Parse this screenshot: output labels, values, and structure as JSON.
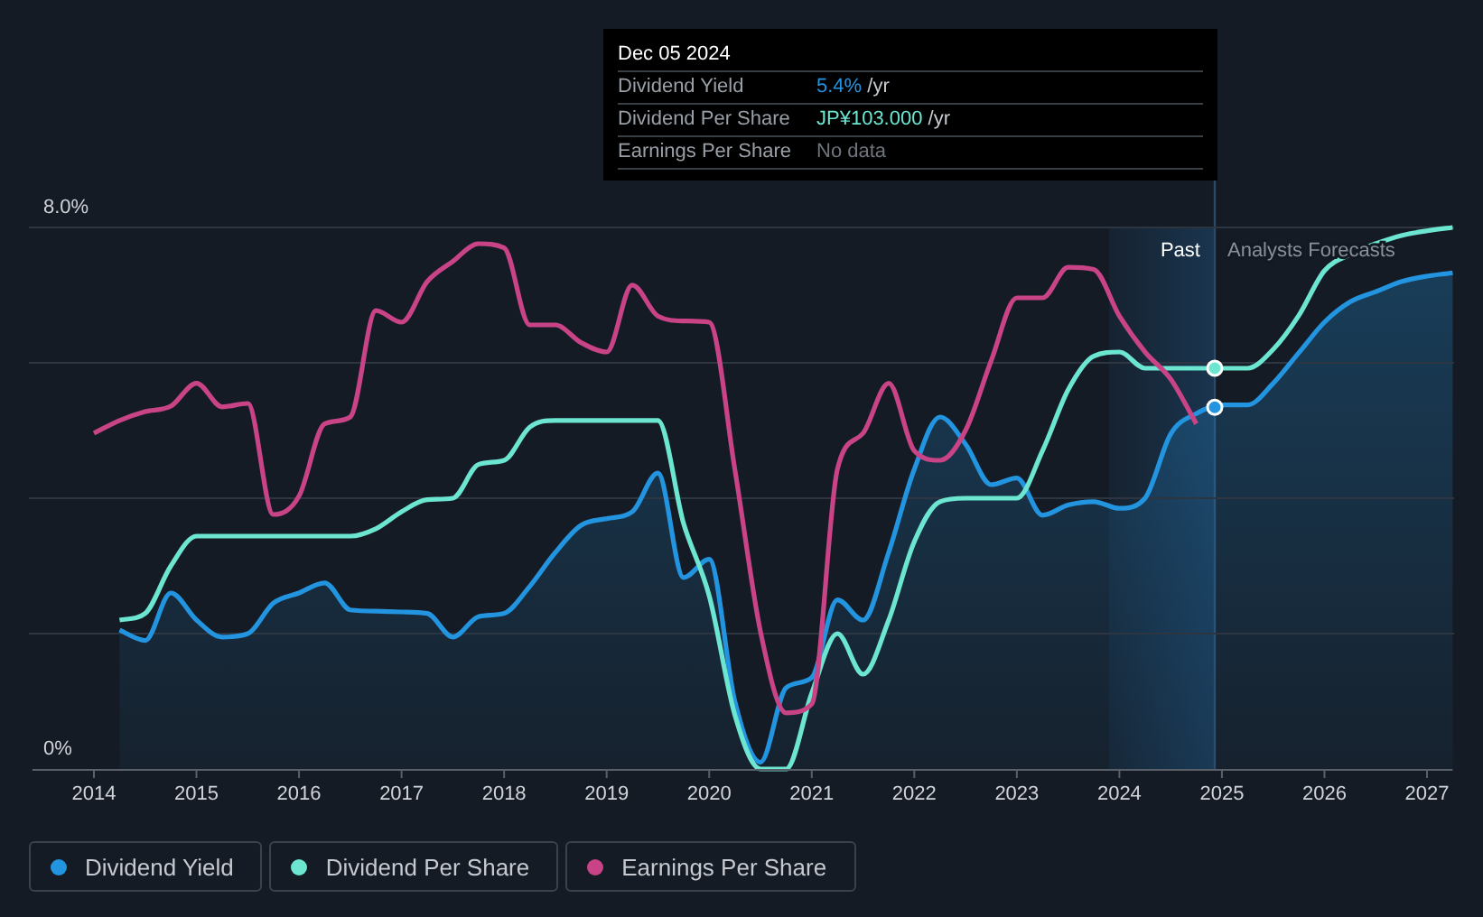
{
  "chart_data": {
    "type": "line",
    "yticks": [
      {
        "value": 0,
        "label": "0%"
      },
      {
        "value": 8,
        "label": "8.0%"
      }
    ],
    "ylim": [
      0,
      8
    ],
    "xticks": [
      2014,
      2015,
      2016,
      2017,
      2018,
      2019,
      2020,
      2021,
      2022,
      2023,
      2024,
      2025,
      2026,
      2027
    ],
    "xlim": [
      2013.4,
      2027.25
    ],
    "x": [
      2014.0,
      2014.25,
      2014.5,
      2014.75,
      2015.0,
      2015.25,
      2015.5,
      2015.75,
      2016.0,
      2016.25,
      2016.5,
      2016.75,
      2017.0,
      2017.25,
      2017.5,
      2017.75,
      2018.0,
      2018.25,
      2018.5,
      2018.75,
      2019.0,
      2019.25,
      2019.5,
      2019.75,
      2020.0,
      2020.25,
      2020.5,
      2020.75,
      2021.0,
      2021.25,
      2021.5,
      2021.75,
      2022.0,
      2022.25,
      2022.5,
      2022.75,
      2023.0,
      2023.25,
      2023.5,
      2023.75,
      2024.0,
      2024.25,
      2024.5,
      2024.75,
      2025.0,
      2025.25,
      2025.5,
      2025.75,
      2026.0,
      2026.25,
      2026.5,
      2026.75,
      2027.0,
      2027.25
    ],
    "series": [
      {
        "name": "Dividend Yield",
        "color": "#2394df",
        "values": [
          null,
          2.05,
          1.9,
          2.6,
          2.2,
          1.95,
          2.0,
          2.45,
          2.6,
          2.75,
          2.35,
          2.33,
          2.32,
          2.3,
          1.95,
          2.25,
          2.3,
          2.7,
          3.2,
          3.6,
          3.7,
          3.8,
          4.37,
          2.83,
          3.1,
          1.0,
          0.1,
          1.2,
          1.35,
          2.5,
          2.2,
          3.2,
          4.43,
          5.2,
          4.8,
          4.2,
          4.3,
          3.75,
          3.9,
          3.95,
          3.85,
          4.0,
          4.95,
          5.25,
          5.38,
          5.38,
          5.7,
          6.15,
          6.6,
          6.9,
          7.05,
          7.2,
          7.28,
          7.33
        ]
      },
      {
        "name": "Dividend Per Share",
        "color": "#6ce5d1",
        "values": [
          null,
          2.2,
          2.3,
          3.0,
          3.44,
          3.44,
          3.44,
          3.44,
          3.44,
          3.44,
          3.44,
          3.55,
          3.8,
          3.98,
          4.0,
          4.5,
          4.56,
          5.05,
          5.15,
          5.15,
          5.15,
          5.15,
          5.15,
          3.63,
          2.56,
          0.8,
          0,
          0,
          1.12,
          2.0,
          1.4,
          2.2,
          3.36,
          3.95,
          4.0,
          4.0,
          4.0,
          4.7,
          5.6,
          6.1,
          6.16,
          5.92,
          5.92,
          5.92,
          5.92,
          5.92,
          6.2,
          6.7,
          7.36,
          7.6,
          7.76,
          7.88,
          7.95,
          8.0
        ]
      },
      {
        "name": "Earnings Per Share",
        "color": "#c94487",
        "values": [
          4.96,
          5.15,
          5.28,
          5.36,
          5.7,
          5.35,
          5.4,
          3.76,
          4.03,
          5.1,
          5.2,
          6.77,
          6.6,
          7.2,
          7.5,
          7.76,
          7.7,
          6.56,
          6.56,
          6.3,
          6.16,
          7.15,
          6.69,
          6.62,
          6.6,
          4.43,
          2.03,
          0.83,
          0.96,
          4.43,
          4.96,
          5.7,
          4.7,
          4.56,
          5.0,
          6.03,
          6.96,
          6.96,
          7.41,
          7.38,
          6.69,
          6.16,
          5.76,
          5.1,
          null,
          null,
          null,
          null,
          null,
          null,
          null,
          null,
          null,
          null
        ]
      }
    ]
  },
  "period_labels": {
    "past": "Past",
    "forecast": "Analysts Forecasts"
  },
  "tooltip": {
    "date": "Dec 05 2024",
    "rows": [
      {
        "label": "Dividend Yield",
        "value": "5.4%",
        "unit": "/yr",
        "color": "#2394df"
      },
      {
        "label": "Dividend Per Share",
        "value": "JP¥103.000",
        "unit": "/yr",
        "color": "#6ce5d1"
      },
      {
        "label": "Earnings Per Share",
        "value": "No data"
      }
    ]
  }
}
